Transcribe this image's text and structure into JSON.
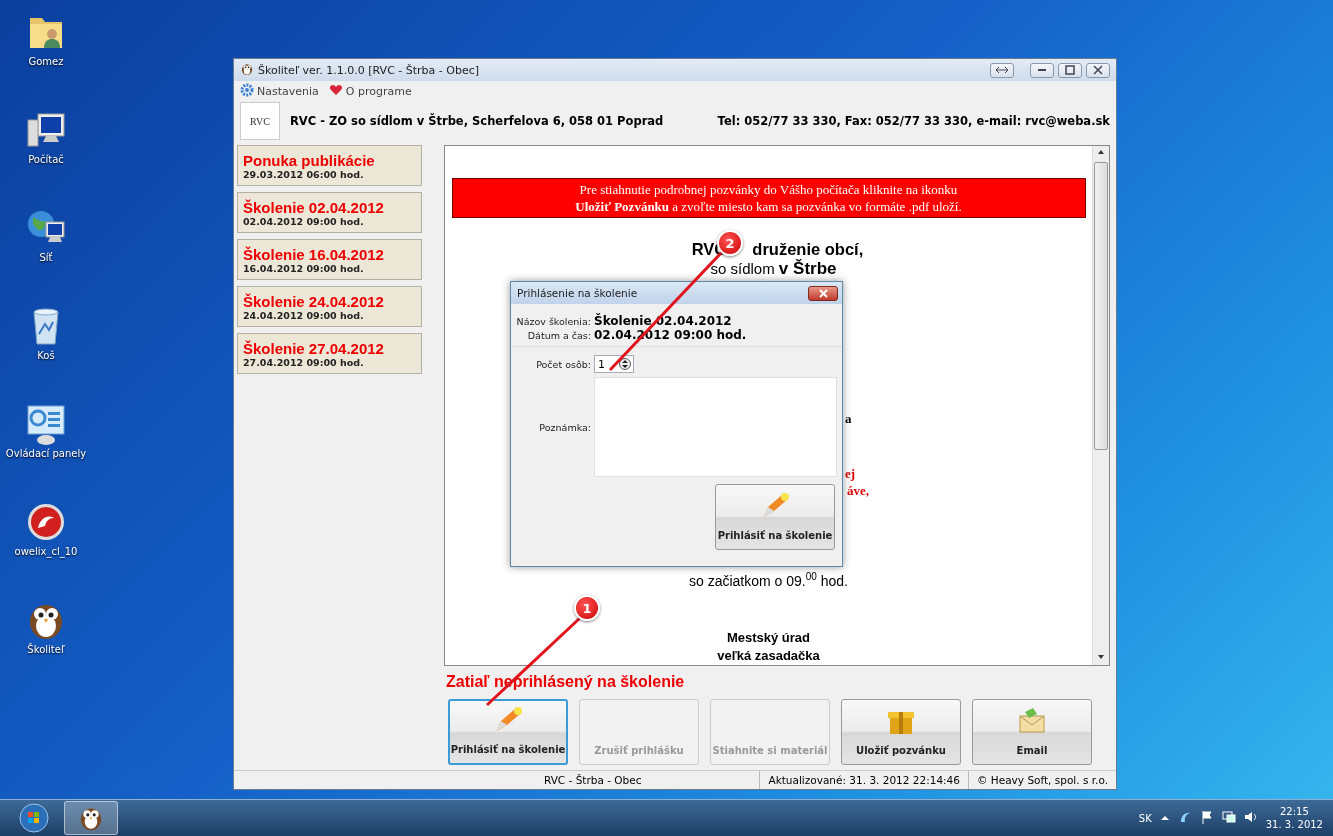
{
  "desktop_icons": [
    {
      "label": "Gomez",
      "kind": "folder"
    },
    {
      "label": "Počítač",
      "kind": "computer"
    },
    {
      "label": "Síť",
      "kind": "network"
    },
    {
      "label": "Koš",
      "kind": "trash"
    },
    {
      "label": "Ovládací panely",
      "kind": "panel"
    },
    {
      "label": "owelix_cl_10",
      "kind": "redapp"
    },
    {
      "label": "Školiteľ",
      "kind": "owl"
    }
  ],
  "window": {
    "title": "Školiteľ ver. 1.1.0.0  [RVC - Štrba - Obec]"
  },
  "menu": [
    {
      "label": "Nastavenia",
      "kind": "gear"
    },
    {
      "label": "O programe",
      "kind": "heart"
    }
  ],
  "header": {
    "logo_text": "RVC",
    "organization": "RVC - ZO so sídlom v Štrbe, Scherfelova 6, 058 01 Poprad",
    "contact": "Tel: 052/77 33 330, Fax: 052/77 33 330, e-mail: rvc@weba.sk"
  },
  "sidebar": {
    "items": [
      {
        "title": "Ponuka publikácie",
        "date": "29.03.2012 06:00 hod."
      },
      {
        "title": "Školenie 02.04.2012",
        "date": "02.04.2012 09:00 hod."
      },
      {
        "title": "Školenie 16.04.2012",
        "date": "16.04.2012 09:00 hod."
      },
      {
        "title": "Školenie 24.04.2012",
        "date": "24.04.2012 09:00 hod."
      },
      {
        "title": "Školenie 27.04.2012",
        "date": "27.04.2012 09:00 hod."
      }
    ]
  },
  "content": {
    "banner": [
      "Pre stiahnutie podrobnej pozvánky do Vášho počítača kliknite na ikonku",
      "**Uložiť Pozvánku** a zvoľte miesto kam sa pozvánka vo formáte .pdf uloží."
    ],
    "heading_left": "RVC",
    "heading_right": "druženie obcí,",
    "subheading": "so sídlom **v Štrbe**",
    "fragments": [
      {
        "text": "a",
        "kind": "plain"
      },
      {
        "text": "ej",
        "kind": "red"
      },
      {
        "text": "áve,",
        "kind": "red"
      }
    ],
    "start_time": "so začiatkom o 09.$^{00}$ hod.",
    "place": [
      "Mestský úrad",
      "veľká zasadačka"
    ]
  },
  "registration_status": "Zatiaľ neprihlásený na školenie",
  "buttons": [
    {
      "label": "Prihlásiť na školenie",
      "kind": "pen",
      "disabled": false,
      "selected": true
    },
    {
      "label": "Zrušiť prihlášku",
      "kind": "none",
      "disabled": true,
      "selected": false
    },
    {
      "label": "Stiahnite si materiál",
      "kind": "none",
      "disabled": true,
      "selected": false
    },
    {
      "label": "Uložiť pozvánku",
      "kind": "box",
      "disabled": false,
      "selected": false
    },
    {
      "label": "Email",
      "kind": "mail",
      "disabled": false,
      "selected": false
    }
  ],
  "status_bar": [
    "RVC - Štrba - Obec",
    "Aktualizované: 31. 3. 2012 22:14:46",
    "© Heavy Soft, spol. s r.o."
  ],
  "dialog": {
    "title": "Prihlásenie na školenie",
    "fields": [
      {
        "label": "Názov školenia:",
        "value": "Školenie 02.04.2012"
      },
      {
        "label": "Dátum a čas:",
        "value": "02.04.2012 09:00 hod."
      }
    ],
    "count_label": "Počet osôb:",
    "count_value": "1",
    "note_label": "Poznámka:",
    "submit": "Prihlásiť na školenie"
  },
  "callouts": [
    {
      "number": "1"
    },
    {
      "number": "2"
    }
  ],
  "taskbar": {
    "language": "SK",
    "time": "22:15",
    "date": "31. 3. 2012"
  }
}
